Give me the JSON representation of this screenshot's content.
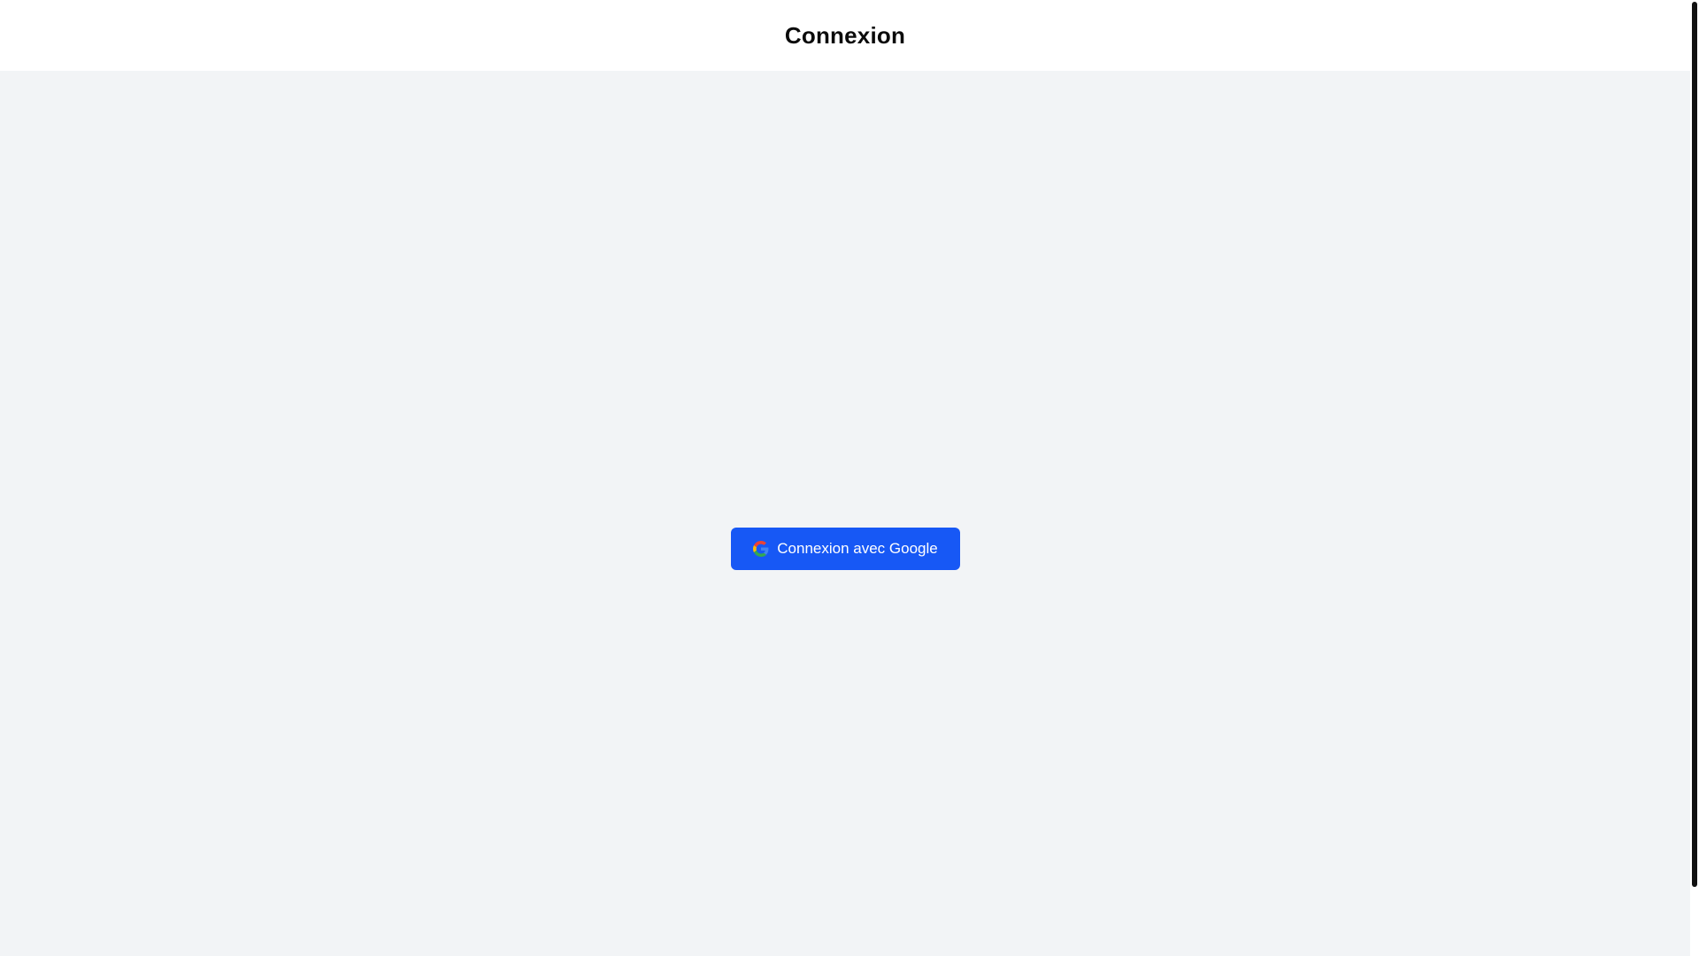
{
  "header": {
    "title": "Connexion"
  },
  "login": {
    "button_label": "Connexion avec Google",
    "button_icon": "google-logo-icon"
  },
  "colors": {
    "accent": "#1758f5",
    "background": "#f2f4f6",
    "header_background": "#ffffff",
    "title_text": "#0b0b0b",
    "scrollbar_thumb": "#111111",
    "google_blue": "#4285f4",
    "google_red": "#ea4335",
    "google_yellow": "#fbbc05",
    "google_green": "#34a853"
  }
}
